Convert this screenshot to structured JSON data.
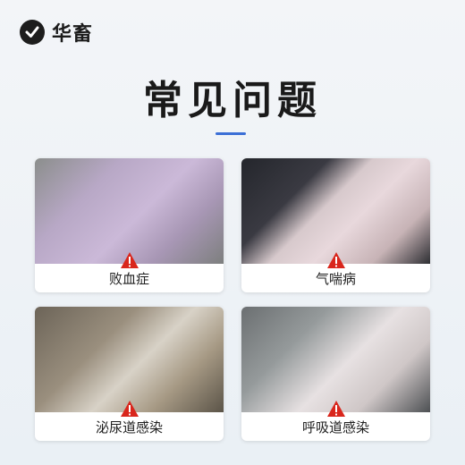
{
  "brand": {
    "name": "华畜",
    "logo_icon": "checkmark-logo-icon"
  },
  "header": {
    "title": "常见问题"
  },
  "cards": [
    {
      "label": "败血症",
      "icon": "warning-icon"
    },
    {
      "label": "气喘病",
      "icon": "warning-icon"
    },
    {
      "label": "泌尿道感染",
      "icon": "warning-icon"
    },
    {
      "label": "呼吸道感染",
      "icon": "warning-icon"
    }
  ],
  "colors": {
    "accent": "#3b6fd6",
    "warning": "#d9261c"
  }
}
